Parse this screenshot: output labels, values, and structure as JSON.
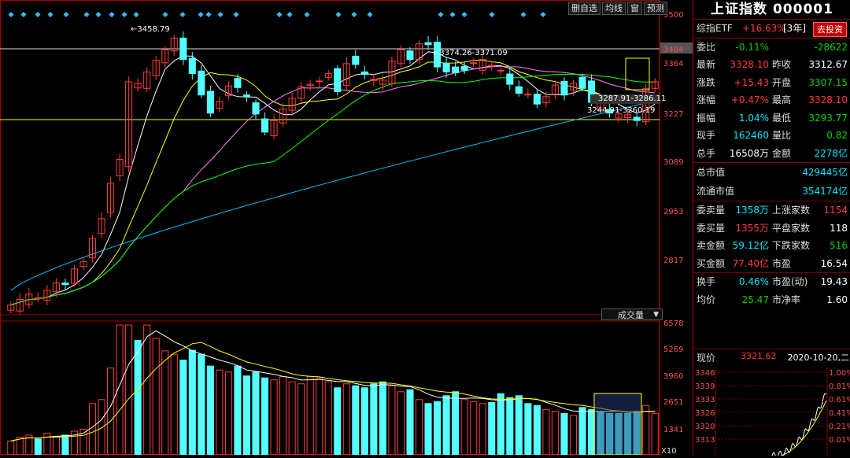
{
  "toolbar": {
    "buttons": [
      "删自选",
      "均线",
      "窗",
      "预测"
    ]
  },
  "price_axis": {
    "labels": [
      "3500",
      "3404",
      "3364",
      "3227",
      "3089",
      "2953",
      "2817"
    ],
    "highlight": "3404"
  },
  "annotations": {
    "high": "3458.79",
    "range1": "3374.26-3371.09",
    "range2": "3287.91-3286.11",
    "range3": "3244.91-3260.19"
  },
  "volume": {
    "label": "成交量",
    "axis": [
      "6578",
      "5269",
      "3960",
      "2651",
      "1341"
    ],
    "unit": "X10"
  },
  "panel": {
    "title": "上证指数 000001",
    "etf_label": "综指ETF",
    "etf_value": "+16.63%",
    "etf_period": "[3年]",
    "invest_btn": "去投资",
    "rows1": [
      {
        "l": "委比",
        "v": "-0.11%",
        "vc": "green",
        "r": "",
        "rv": "-28622",
        "rvc": "green"
      },
      {
        "l": "最新",
        "v": "3328.10",
        "vc": "red",
        "r": "昨收",
        "rv": "3312.67",
        "rvc": "white"
      },
      {
        "l": "涨跌",
        "v": "+15.43",
        "vc": "red",
        "r": "开盘",
        "rv": "3307.15",
        "rvc": "green"
      },
      {
        "l": "涨幅",
        "v": "+0.47%",
        "vc": "red",
        "r": "最高",
        "rv": "3328.10",
        "rvc": "red"
      },
      {
        "l": "振幅",
        "v": "1.04%",
        "vc": "cyan",
        "r": "最低",
        "rv": "3293.77",
        "rvc": "green"
      },
      {
        "l": "现手",
        "v": "162460",
        "vc": "cyan",
        "r": "量比",
        "rv": "0.82",
        "rvc": "green"
      },
      {
        "l": "总手",
        "v": "16508万",
        "vc": "white",
        "r": "金额",
        "rv": "2278亿",
        "rvc": "cyan"
      }
    ],
    "market_value": {
      "l": "总市值",
      "v": "429445亿"
    },
    "float_value": {
      "l": "流通市值",
      "v": "354174亿"
    },
    "rows2": [
      {
        "l": "委卖量",
        "v": "1358万",
        "vc": "cyan",
        "r": "上涨家数",
        "rv": "1154",
        "rvc": "red"
      },
      {
        "l": "委买量",
        "v": "1355万",
        "vc": "red",
        "r": "平盘家数",
        "rv": "118",
        "rvc": "white"
      },
      {
        "l": "卖金额",
        "v": "59.12亿",
        "vc": "cyan",
        "r": "下跌家数",
        "rv": "516",
        "rvc": "green"
      },
      {
        "l": "买金额",
        "v": "77.40亿",
        "vc": "red",
        "r": "市盈",
        "rv": "16.54",
        "rvc": "white"
      }
    ],
    "rows3": [
      {
        "l": "换手",
        "v": "0.46%",
        "vc": "cyan",
        "r": "市盈(动)",
        "rv": "19.43",
        "rvc": "white"
      },
      {
        "l": "均价",
        "v": "25.47",
        "vc": "green",
        "r": "市净率",
        "rv": "1.60",
        "rvc": "white"
      }
    ],
    "mini": {
      "now_label": "现价",
      "now": "3321.62",
      "date": "2020-10-20,二",
      "prices": [
        "3346",
        "3339",
        "3333",
        "3326",
        "3320",
        "3313"
      ],
      "pcts": [
        "1.00%",
        "0.81%",
        "0.61%",
        "0.41%",
        "0.21%",
        "0.01%"
      ]
    }
  },
  "colors": {
    "up": "#ff3c3c",
    "down": "#54ffff",
    "ma5": "#ffffff",
    "ma10": "#ffff00",
    "ma20": "#ff80ff",
    "ma30": "#00ff00",
    "ma60": "#00c0ff"
  }
}
